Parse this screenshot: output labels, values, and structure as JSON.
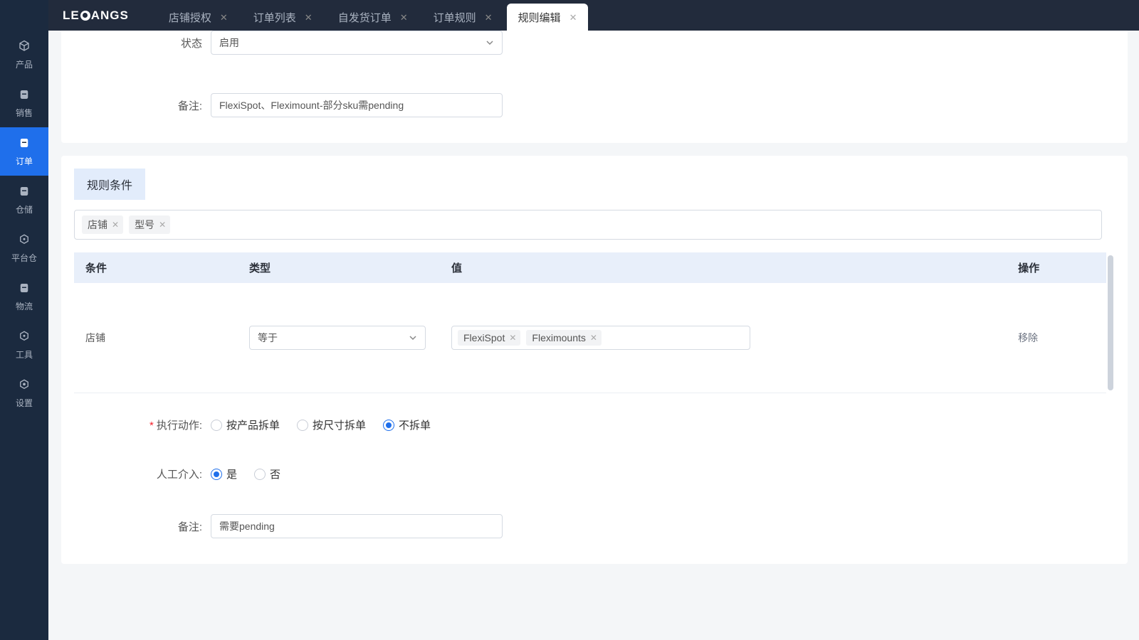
{
  "brand": "LECANGS",
  "tabs": [
    {
      "label": "店铺授权",
      "closable": true,
      "active": false
    },
    {
      "label": "订单列表",
      "closable": true,
      "active": false
    },
    {
      "label": "自发货订单",
      "closable": true,
      "active": false
    },
    {
      "label": "订单规则",
      "closable": true,
      "active": false
    },
    {
      "label": "规则编辑",
      "closable": true,
      "active": true
    }
  ],
  "sidebar": [
    {
      "label": "产品",
      "icon": "cube",
      "active": false
    },
    {
      "label": "销售",
      "icon": "doc",
      "active": false
    },
    {
      "label": "订单",
      "icon": "doc",
      "active": true
    },
    {
      "label": "仓储",
      "icon": "doc",
      "active": false
    },
    {
      "label": "平台仓",
      "icon": "hex",
      "active": false
    },
    {
      "label": "物流",
      "icon": "doc",
      "active": false
    },
    {
      "label": "工具",
      "icon": "hex",
      "active": false
    },
    {
      "label": "设置",
      "icon": "gear",
      "active": false
    }
  ],
  "form_top": {
    "status_label": "状态",
    "status_value": "启用",
    "remark_label": "备注:",
    "remark_value": "FlexiSpot、Fleximount-部分sku需pending"
  },
  "conditions": {
    "section_title": "规则条件",
    "filter_tags": [
      "店铺",
      "型号"
    ],
    "table": {
      "headers": {
        "cond": "条件",
        "type": "类型",
        "value": "值",
        "op": "操作"
      },
      "rows": [
        {
          "cond": "店铺",
          "type": "等于",
          "values": [
            "FlexiSpot",
            "Fleximounts"
          ],
          "op": "移除"
        }
      ]
    }
  },
  "actions": {
    "exec_label": "执行动作:",
    "exec_options": [
      {
        "label": "按产品拆单",
        "checked": false
      },
      {
        "label": "按尺寸拆单",
        "checked": false
      },
      {
        "label": "不拆单",
        "checked": true
      }
    ],
    "manual_label": "人工介入:",
    "manual_options": [
      {
        "label": "是",
        "checked": true
      },
      {
        "label": "否",
        "checked": false
      }
    ],
    "remark_label": "备注:",
    "remark_value": "需要pending"
  }
}
